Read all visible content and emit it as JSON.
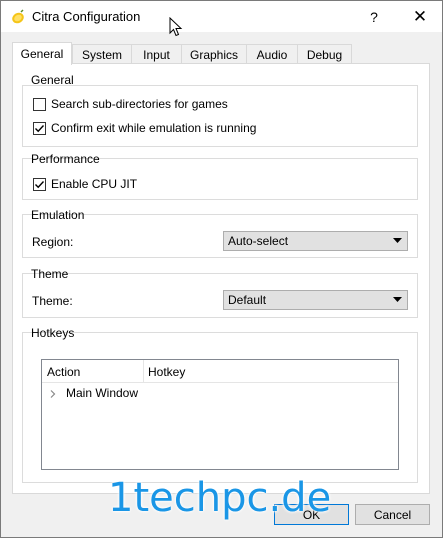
{
  "window": {
    "title": "Citra Configuration",
    "help_label": "?",
    "close_label": "✕"
  },
  "tabs": [
    {
      "label": "General",
      "active": true
    },
    {
      "label": "System",
      "active": false
    },
    {
      "label": "Input",
      "active": false
    },
    {
      "label": "Graphics",
      "active": false
    },
    {
      "label": "Audio",
      "active": false
    },
    {
      "label": "Debug",
      "active": false
    }
  ],
  "general": {
    "title": "General",
    "search_subdirs": {
      "label": "Search sub-directories for games",
      "checked": false
    },
    "confirm_exit": {
      "label": "Confirm exit while emulation is running",
      "checked": true
    }
  },
  "performance": {
    "title": "Performance",
    "cpu_jit": {
      "label": "Enable CPU JIT",
      "checked": true
    }
  },
  "emulation": {
    "title": "Emulation",
    "region_label": "Region:",
    "region_value": "Auto-select"
  },
  "theme": {
    "title": "Theme",
    "theme_label": "Theme:",
    "theme_value": "Default"
  },
  "hotkeys": {
    "title": "Hotkeys",
    "columns": [
      "Action",
      "Hotkey"
    ],
    "rows": [
      {
        "label": "Main Window"
      }
    ]
  },
  "buttons": {
    "ok": "OK",
    "cancel": "Cancel"
  },
  "watermark": "1techpc.de",
  "colors": {
    "accent": "#0078d7",
    "watermark": "#1a96e6"
  }
}
